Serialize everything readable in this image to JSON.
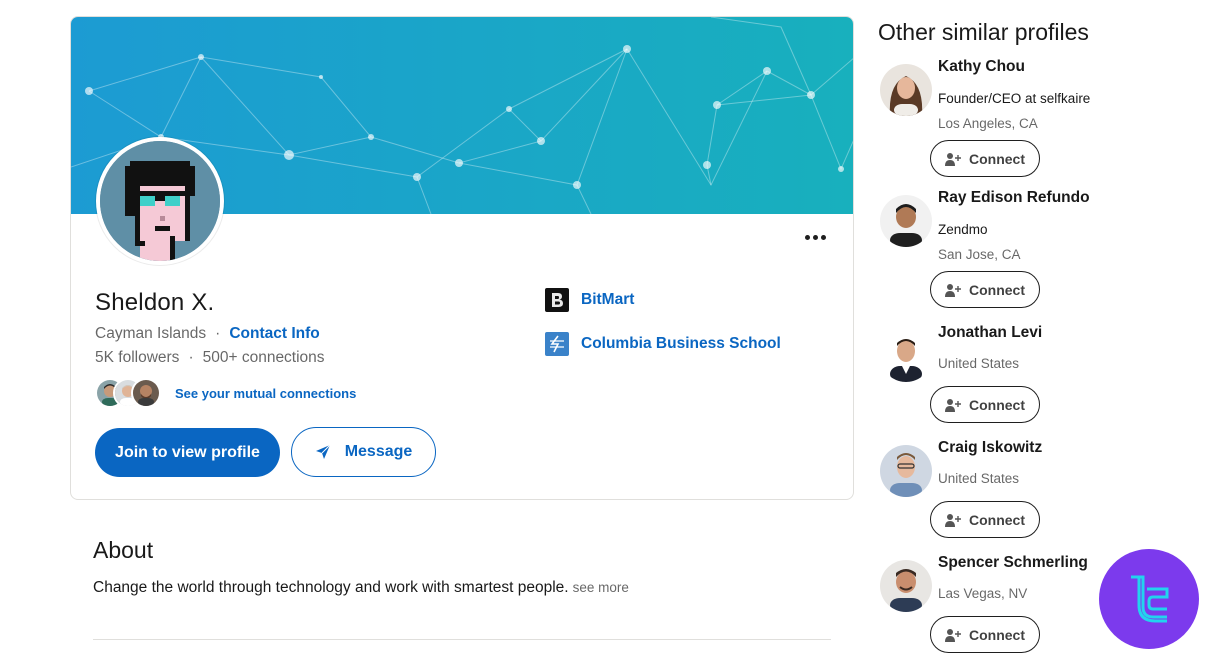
{
  "profile": {
    "name": "Sheldon X.",
    "location": "Cayman Islands",
    "contact_info": "Contact Info",
    "followers": "5K followers",
    "connections": "500+ connections",
    "mutual_connections": "See your mutual connections",
    "join_button": "Join to view profile",
    "message_button": "Message"
  },
  "companies": [
    {
      "name": "BitMart",
      "logo_icon": "bitmart-logo-icon"
    },
    {
      "name": "Columbia Business School",
      "logo_icon": "columbia-logo-icon"
    }
  ],
  "about": {
    "title": "About",
    "text": "Change the world through technology and work with smartest people.",
    "see_more": "see more"
  },
  "similar_profiles": {
    "title": "Other similar profiles",
    "connect_label": "Connect",
    "people": [
      {
        "name": "Kathy Chou",
        "headline": "Founder/CEO at selfkaire",
        "location": "Los Angeles, CA"
      },
      {
        "name": "Ray Edison Refundo",
        "headline": "Zendmo",
        "location": "San Jose, CA"
      },
      {
        "name": "Jonathan Levi",
        "location": "United States"
      },
      {
        "name": "Craig Iskowitz",
        "location": "United States"
      },
      {
        "name": "Spencer Schmerling",
        "location": "Las Vegas, NV"
      }
    ]
  },
  "colors": {
    "accent": "#0a66c2",
    "banner_start": "#1a9fd1",
    "banner_end": "#1aaeb8",
    "watermark": "#7c3aed"
  }
}
